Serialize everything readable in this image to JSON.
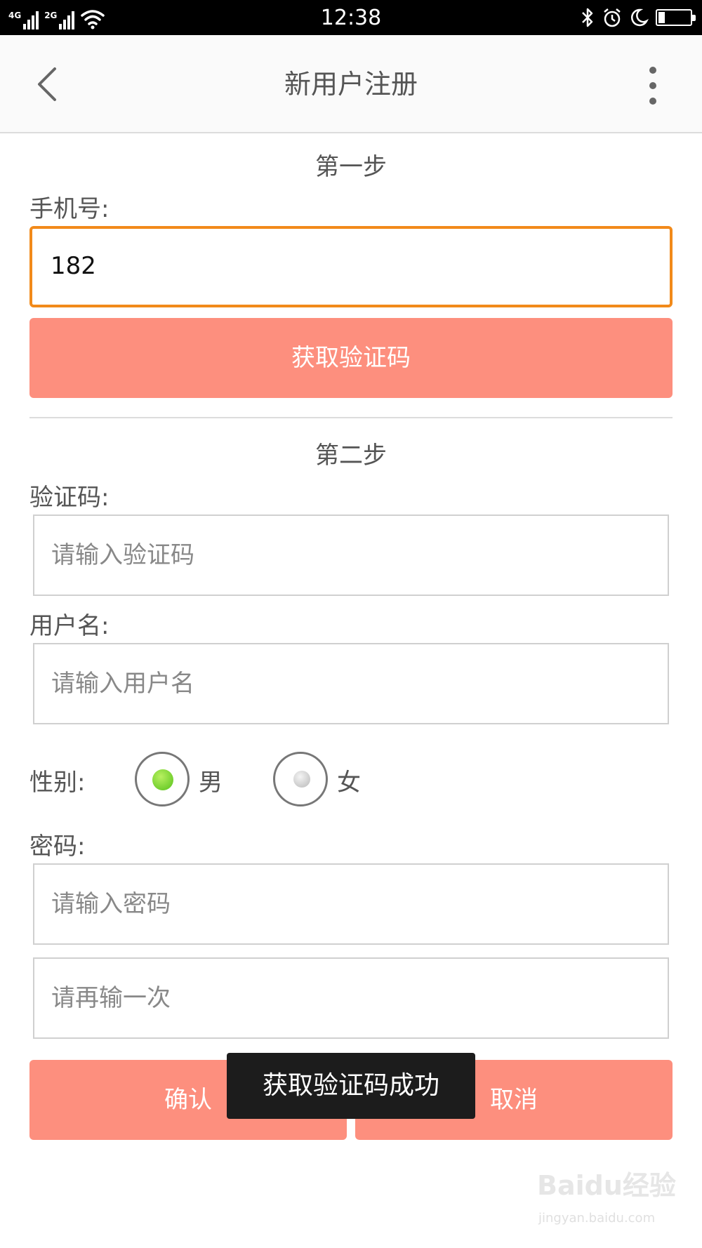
{
  "status_bar": {
    "network_1": "4G",
    "network_2": "2G",
    "time": "12:38",
    "battery_level": 0.2
  },
  "header": {
    "title": "新用户注册",
    "back_icon": "chevron-left-icon",
    "menu_icon": "more-vertical-icon"
  },
  "step1": {
    "title": "第一步",
    "phone_label": "手机号:",
    "phone_value": "182",
    "get_code_button": "获取验证码"
  },
  "step2": {
    "title": "第二步",
    "code_label": "验证码:",
    "code_placeholder": "请输入验证码",
    "username_label": "用户名:",
    "username_placeholder": "请输入用户名",
    "gender_label": "性别:",
    "gender_options": [
      "男",
      "女"
    ],
    "gender_selected": "男",
    "password_label": "密码:",
    "password_placeholder": "请输入密码",
    "password_confirm_placeholder": "请再输一次"
  },
  "actions": {
    "confirm_button": "确认",
    "cancel_button": "取消"
  },
  "toast": "获取验证码成功",
  "watermark": {
    "main": "Baidu经验",
    "sub": "jingyan.baidu.com"
  },
  "colors": {
    "accent_button": "#fd8f7e",
    "focus_border": "#f28a1a",
    "radio_checked": "#56c11a"
  }
}
